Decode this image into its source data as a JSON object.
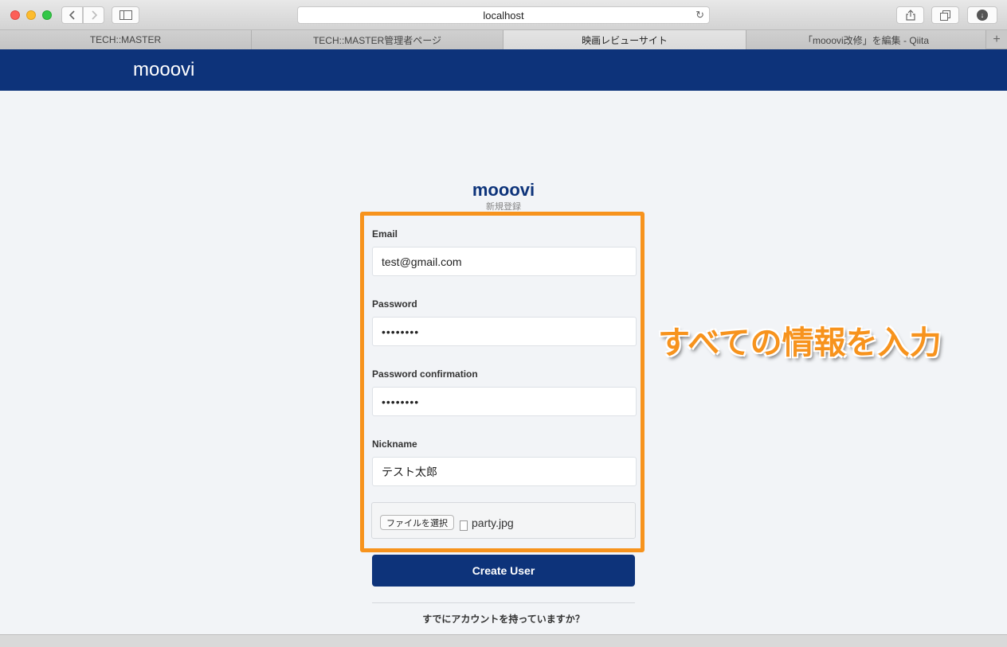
{
  "browser": {
    "url": "localhost",
    "tabs": [
      {
        "label": "TECH::MASTER",
        "active": false
      },
      {
        "label": "TECH::MASTER管理者ページ",
        "active": false
      },
      {
        "label": "映画レビューサイト",
        "active": true
      },
      {
        "label": "「mooovi改修」を編集 - Qiita",
        "active": false
      }
    ],
    "icons": {
      "back": "chevron-left-icon",
      "forward": "chevron-right-icon",
      "sidebar": "sidebar-icon",
      "reload": "reload-icon",
      "share": "share-icon",
      "tabs": "tabs-overview-icon",
      "download": "download-icon",
      "new_tab": "plus-icon"
    }
  },
  "header": {
    "brand": "mooovi"
  },
  "form": {
    "logo": "mooovi",
    "subtitle": "新規登録",
    "email": {
      "label": "Email",
      "value": "test@gmail.com"
    },
    "password": {
      "label": "Password",
      "value": "••••••••"
    },
    "password_confirmation": {
      "label": "Password confirmation",
      "value": "••••••••"
    },
    "nickname": {
      "label": "Nickname",
      "value": "テスト太郎"
    },
    "file": {
      "button_label": "ファイルを選択",
      "file_name": "party.jpg"
    },
    "submit_label": "Create User",
    "login_link": "すでにアカウントを持っていますか？"
  },
  "annotation": {
    "text": "すべての情報を入力"
  },
  "colors": {
    "header_bg": "#0d337a",
    "accent_orange": "#f7931d",
    "page_bg": "#f2f4f7"
  }
}
